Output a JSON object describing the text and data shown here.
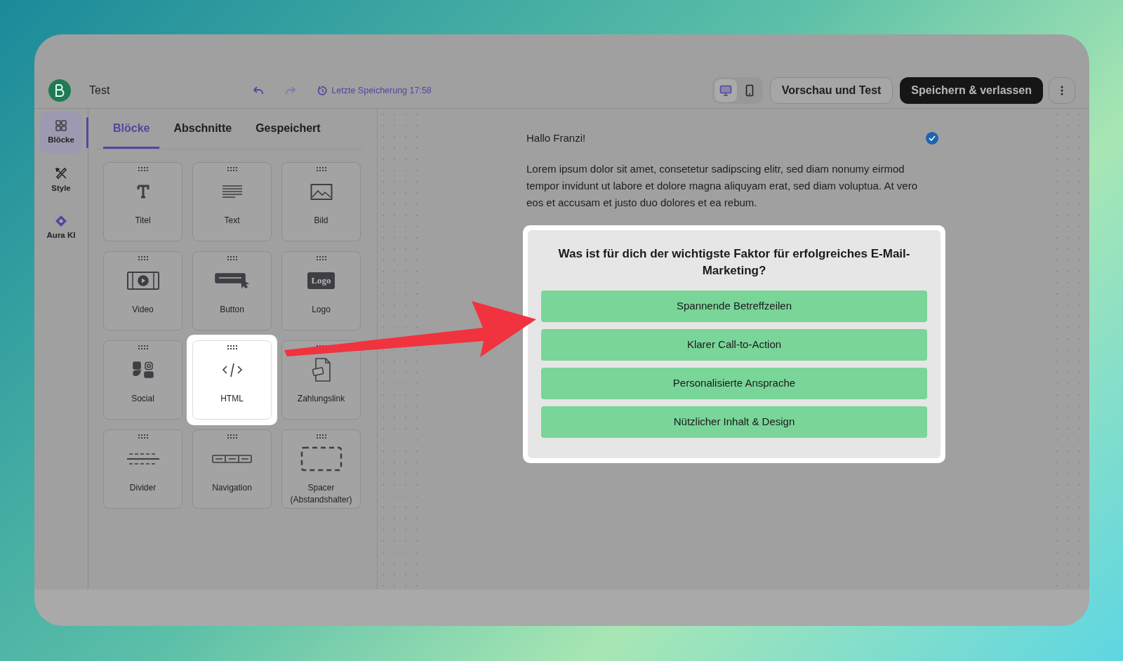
{
  "header": {
    "title": "Test",
    "last_saved": "Letzte Speicherung 17:58",
    "devices": [
      {
        "kind": "desktop",
        "selected": true
      },
      {
        "kind": "mobile",
        "selected": false
      }
    ],
    "preview_button": "Vorschau und Test",
    "save_button": "Speichern & verlassen"
  },
  "rail": [
    {
      "kind": "blocks",
      "label": "Blöcke",
      "selected": true
    },
    {
      "kind": "style",
      "label": "Style",
      "selected": false
    },
    {
      "kind": "ai",
      "label": "Aura KI",
      "selected": false
    }
  ],
  "tabs": [
    {
      "label": "Blöcke",
      "selected": true
    },
    {
      "label": "Abschnitte",
      "selected": false
    },
    {
      "label": "Gespeichert",
      "selected": false
    }
  ],
  "blocks": [
    {
      "kind": "title",
      "label": "Titel",
      "highlighted": false
    },
    {
      "kind": "text",
      "label": "Text",
      "highlighted": false
    },
    {
      "kind": "image",
      "label": "Bild",
      "highlighted": false
    },
    {
      "kind": "video",
      "label": "Video",
      "highlighted": false
    },
    {
      "kind": "button",
      "label": "Button",
      "highlighted": false
    },
    {
      "kind": "logo",
      "label": "Logo",
      "badge": "Logo",
      "highlighted": false
    },
    {
      "kind": "social",
      "label": "Social",
      "highlighted": false
    },
    {
      "kind": "html",
      "label": "HTML",
      "highlighted": true
    },
    {
      "kind": "payment",
      "label": "Zahlungslink",
      "highlighted": false
    },
    {
      "kind": "divider",
      "label": "Divider",
      "highlighted": false
    },
    {
      "kind": "navigation",
      "label": "Navigation",
      "highlighted": false
    },
    {
      "kind": "spacer",
      "label": "Spacer (Abstandshalter)",
      "highlighted": false
    }
  ],
  "canvas": {
    "greeting": "Hallo Franzi!",
    "body": "Lorem ipsum dolor sit amet, consetetur sadipscing elitr, sed diam nonumy eirmod tempor invidunt ut labore et dolore magna aliquyam erat, sed diam voluptua. At vero eos et accusam et justo duo dolores et ea rebum.",
    "poll": {
      "question": "Was ist für dich der wichtigste Faktor für erfolgreiches E-Mail-Marketing?",
      "highlighted": true,
      "options": [
        "Spannende Betreffzeilen",
        "Klarer Call-to-Action",
        "Personalisierte Ansprache",
        "Nützlicher Inhalt & Design"
      ]
    }
  }
}
